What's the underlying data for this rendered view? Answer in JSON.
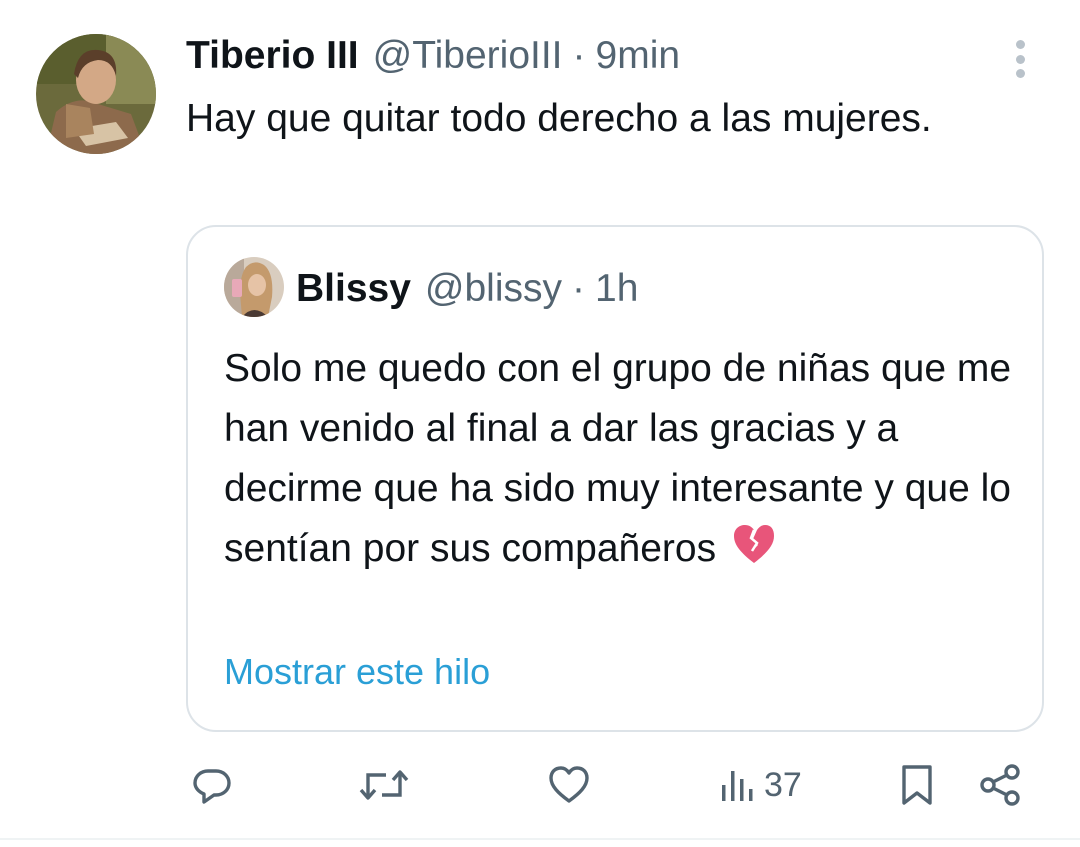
{
  "tweet": {
    "author_name": "Tiberio III",
    "author_handle": "@TiberioIII",
    "separator": "·",
    "time": "9min",
    "text": "Hay que quitar todo derecho a las mujeres."
  },
  "quoted": {
    "author_name": "Blissy",
    "author_handle": "@blissy",
    "separator": "·",
    "time": "1h",
    "text": "Solo me quedo con el grupo de niñas que me han venido al final a dar las gracias y a decirme que ha sido muy interesante y que lo sentían por sus compañeros",
    "emoji": "broken-heart",
    "show_thread_label": "Mostrar este hilo"
  },
  "actions": {
    "views_count": "37"
  },
  "icons": [
    "more-icon",
    "reply-icon",
    "retweet-icon",
    "like-icon",
    "views-icon",
    "bookmark-icon",
    "share-icon"
  ],
  "colors": {
    "text": "#0f1419",
    "secondary": "#536471",
    "link": "#2a9fd6",
    "border": "#dde3e8"
  }
}
